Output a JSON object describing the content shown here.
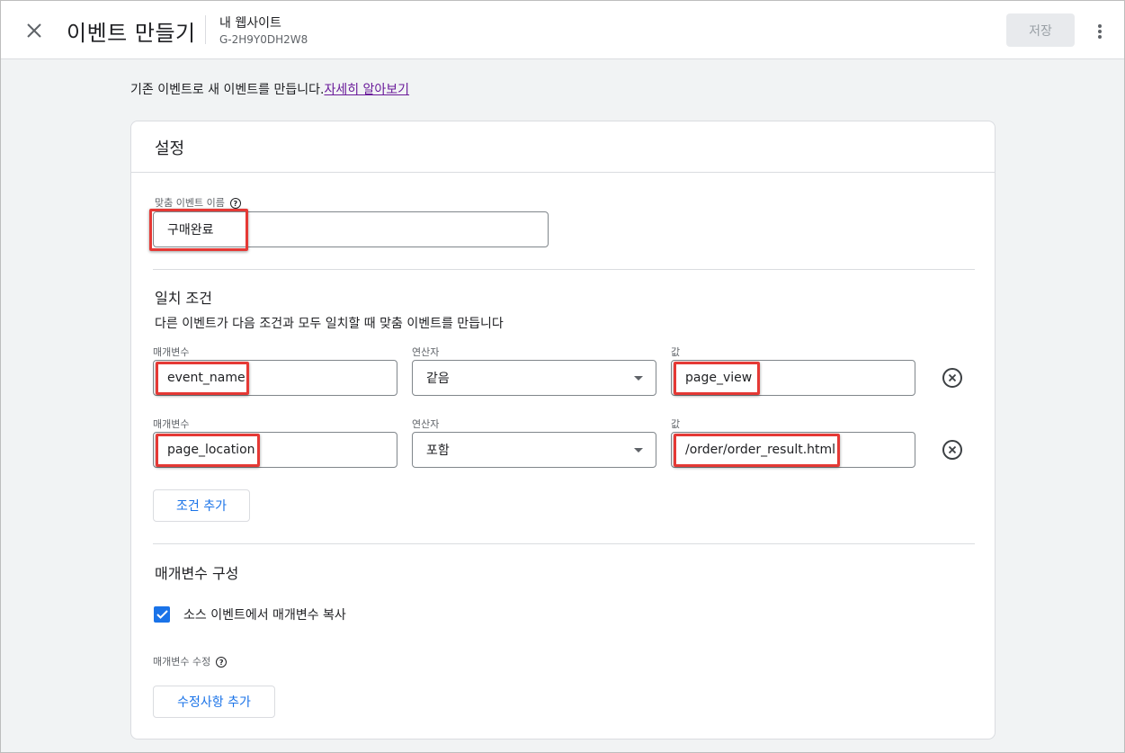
{
  "header": {
    "title": "이벤트 만들기",
    "property_name": "내 웹사이트",
    "property_id": "G-2H9Y0DH2W8",
    "save_label": "저장"
  },
  "intro": {
    "text": "기존 이벤트로 새 이벤트를 만듭니다.",
    "link": "자세히 알아보기"
  },
  "settings": {
    "title": "설정",
    "custom_event_label": "맞춤 이벤트 이름",
    "custom_event_value": "구매완료"
  },
  "matching": {
    "title": "일치 조건",
    "description": "다른 이벤트가 다음 조건과 모두 일치할 때 맞춤 이벤트를 만듭니다",
    "conditions": [
      {
        "param_label": "매개변수",
        "param": "event_name",
        "operator_label": "연산자",
        "operator": "같음",
        "value_label": "값",
        "value": "page_view"
      },
      {
        "param_label": "매개변수",
        "param": "page_location",
        "operator_label": "연산자",
        "operator": "포함",
        "value_label": "값",
        "value": "/order/order_result.html"
      }
    ],
    "add_condition_label": "조건 추가"
  },
  "param_config": {
    "title": "매개변수 구성",
    "copy_label": "소스 이벤트에서 매개변수 복사",
    "copy_checked": true,
    "modify_label": "매개변수 수정",
    "add_modification_label": "수정사항 추가"
  },
  "colors": {
    "accent": "#1a73e8",
    "highlight": "#e53935"
  },
  "icons": [
    "close-icon",
    "more-vert-icon",
    "help-icon",
    "dropdown-arrow-icon",
    "remove-circle-icon",
    "check-icon"
  ]
}
